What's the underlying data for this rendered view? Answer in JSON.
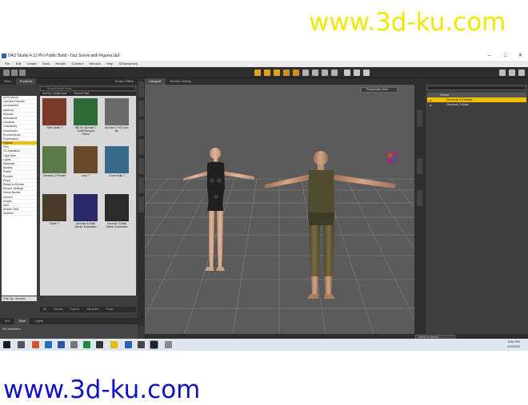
{
  "watermark": {
    "top": "www.3d-ku.com",
    "bottom": "www.3d-ku.com"
  },
  "window": {
    "title": "DAZ Studio 4.12 Pro Public Build - Daz Scene with Figures.duf",
    "controls": [
      "–",
      "□",
      "✕"
    ]
  },
  "menu": [
    "File",
    "Edit",
    "Create",
    "Tools",
    "Render",
    "Connect",
    "Window",
    "Help",
    "3DSymphony"
  ],
  "left_panel": {
    "tabs": [
      "Files",
      "Products"
    ],
    "filter_label": "Smart Offline",
    "search_placeholder": "Search Smart Hints",
    "sort_label": "Sort by: Install Date",
    "sort2_label": "Recent First",
    "categories": [
      "All Products",
      "Last and Favorite",
      "Accessories",
      "Anatomy",
      "Animals",
      "Animations",
      "Cameras",
      "Characters",
      "Documents",
      "Environments",
      "Expressions",
      "Figures",
      "Film",
      "G3 Animation",
      "Light Sets",
      "Lights",
      "Materials",
      "Morphs",
      "Poses",
      "Presets",
      "Props",
      "Ready to Render",
      "Render Settings",
      "Scene Builder",
      "Scenes",
      "Scripts",
      "Sets",
      "Shader Sets",
      "Shaders"
    ],
    "selected_category": "Figures",
    "thumbs": [
      {
        "caption": "Trish Smile 7"
      },
      {
        "caption": "IBE for Michael 7 Outfit Ranged Offers"
      },
      {
        "caption": "Michael 7 HD Kato Bo"
      },
      {
        "caption": "Genesis 3 Female"
      },
      {
        "caption": "Leon 7"
      },
      {
        "caption": "Grace Bulk 7"
      },
      {
        "caption": "Gavin 7"
      },
      {
        "caption": "Genesis 8 Male Starter Essentials"
      },
      {
        "caption": "Genesis 3 Male Starter Essentials"
      }
    ],
    "bottom_tabs": [
      "All",
      "Scenes",
      "Figures",
      "Wardrobe",
      "Props"
    ],
    "filter_by": "Filter By: Genesis"
  },
  "bottom_left": {
    "tabs": [
      "Tool",
      "Style",
      "Lights"
    ],
    "text": "No Selection"
  },
  "viewport": {
    "tabs": [
      "Viewport",
      "Render Library"
    ],
    "camera": "Perspective View"
  },
  "scene": {
    "root": "Scene",
    "items": [
      {
        "label": "Genesis 3 Female",
        "selected": true
      },
      {
        "label": "Genesis 3 Male",
        "selected": false
      }
    ]
  },
  "status": {
    "select_label": "Select a Lesson..."
  },
  "taskbar": {
    "time": "3:34 PM",
    "date": "6/1/2019"
  },
  "colors": {
    "accent": "#f0c000",
    "viewport_bg": "#5b5b5b",
    "panel": "#3c3c3c"
  }
}
